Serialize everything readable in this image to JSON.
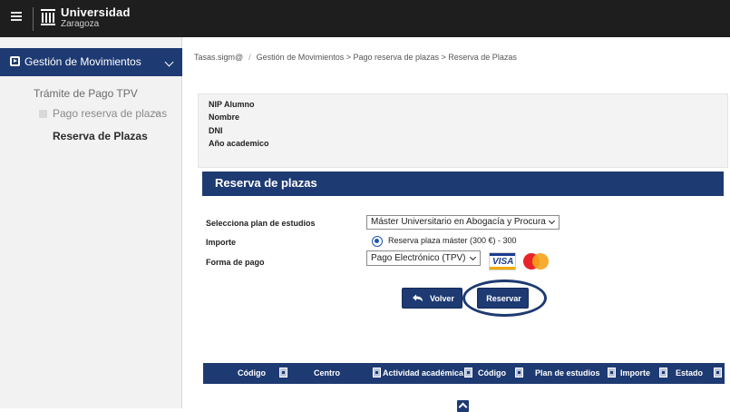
{
  "header": {
    "logo_title": "Universidad",
    "logo_subtitle": "Zaragoza"
  },
  "sidebar": {
    "active_item": "Gestión de Movimientos",
    "items": [
      {
        "label": "Trámite de Pago TPV"
      },
      {
        "label": "Pago reserva de plazas"
      },
      {
        "label": "Reserva de Plazas"
      }
    ]
  },
  "breadcrumb": {
    "root": "Tasas.sigm@",
    "path": "Gestión de Movimientos > Pago reserva de plazas > Reserva de Plazas"
  },
  "student_info": {
    "fields": [
      "NIP Alumno",
      "Nombre",
      "DNI",
      "Año academico"
    ]
  },
  "section": {
    "title": "Reserva de plazas"
  },
  "form": {
    "plan_label": "Selecciona plan de estudios",
    "plan_value": "Máster Universitario en Abogacía y Procura",
    "importe_label": "Importe",
    "importe_option": "Reserva plaza máster (300 €) - 300",
    "pago_label": "Forma de pago",
    "pago_value": "Pago Electrónico (TPV)",
    "visa_text": "VISA"
  },
  "buttons": {
    "volver": "Volver",
    "reservar": "Reservar"
  },
  "table": {
    "columns": [
      "Código",
      "Centro",
      "Actividad académica",
      "Código",
      "Plan de estudios",
      "Importe",
      "Estado"
    ]
  },
  "icons": {
    "menu": "hamburger-icon",
    "logo": "university-building-icon",
    "sidebar_item": "play-square-icon",
    "back": "return-arrow-icon",
    "sort": "sort-icon",
    "scroll_top": "chevron-up-icon"
  },
  "colors": {
    "topbar": "#1e1e1e",
    "primary": "#1e3a72",
    "sidebar_bg": "#f2f2f2"
  }
}
